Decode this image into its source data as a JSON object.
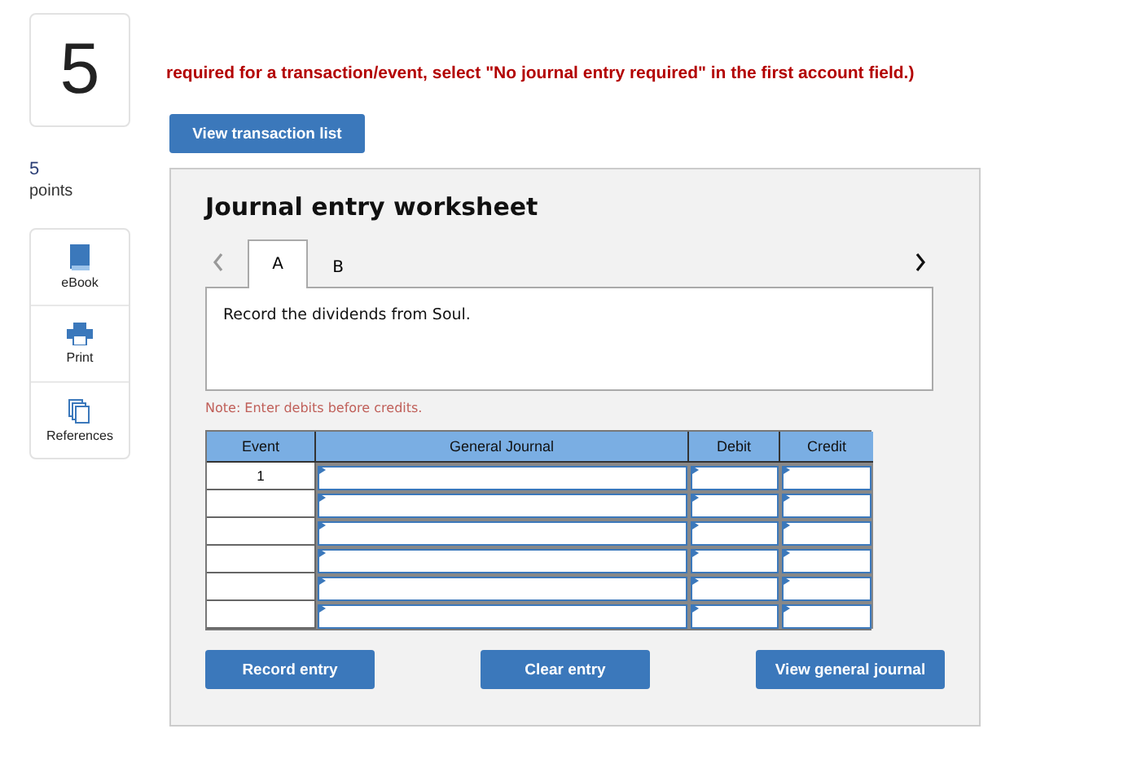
{
  "question_number": "5",
  "instruction": "required for a transaction/event, select \"No journal entry required\" in the first account field.)",
  "transaction_button": "View transaction list",
  "points": {
    "value": "5",
    "label": "points"
  },
  "tools": [
    {
      "kind": "book",
      "label": "eBook"
    },
    {
      "kind": "print",
      "label": "Print"
    },
    {
      "kind": "pages",
      "label": "References"
    }
  ],
  "worksheet": {
    "title": "Journal entry worksheet",
    "tabs": [
      {
        "label": "A",
        "selected": true
      },
      {
        "label": "B",
        "selected": false
      }
    ],
    "prev_enabled": false,
    "next_enabled": true,
    "description": "Record the dividends from Soul.",
    "note": "Note: Enter debits before credits.",
    "table": {
      "columns": [
        "Event",
        "General Journal",
        "Debit",
        "Credit"
      ],
      "rows": [
        {
          "event": "1"
        },
        {},
        {},
        {},
        {},
        {}
      ]
    },
    "buttons": [
      "Record entry",
      "Clear entry",
      "View general journal"
    ]
  }
}
